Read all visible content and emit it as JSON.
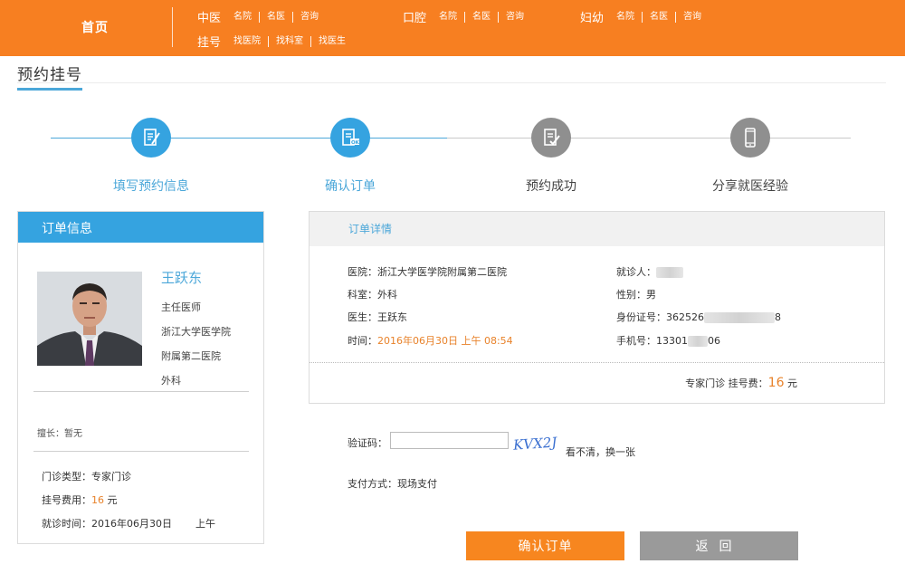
{
  "nav": {
    "home": "首页",
    "groups": [
      {
        "main": "中医",
        "subs": [
          "名院",
          "名医",
          "咨询"
        ]
      },
      {
        "main": "口腔",
        "subs": [
          "名院",
          "名医",
          "咨询"
        ]
      },
      {
        "main": "妇幼",
        "subs": [
          "名院",
          "名医",
          "咨询"
        ]
      },
      {
        "main": "挂号",
        "subs": [
          "找医院",
          "找科室",
          "找医生"
        ]
      }
    ]
  },
  "page_title": "预约挂号",
  "steps": [
    {
      "label": "填写预约信息",
      "state": "done"
    },
    {
      "label": "确认订单",
      "state": "active"
    },
    {
      "label": "预约成功",
      "state": "pending"
    },
    {
      "label": "分享就医经验",
      "state": "pending"
    }
  ],
  "order_info": {
    "title": "订单信息",
    "doctor_name": "王跃东",
    "doctor_title": "主任医师",
    "hospital_line1": "浙江大学医学院",
    "hospital_line2": "附属第二医院",
    "dept": "外科",
    "specialty": "擅长：暂无",
    "clinic_type_label": "门诊类型：",
    "clinic_type": "专家门诊",
    "fee_label": "挂号费用：",
    "fee_value": "16",
    "fee_unit": " 元",
    "visit_time_label": "就诊时间：",
    "visit_date": "2016年06月30日",
    "visit_period": "上午"
  },
  "order_detail": {
    "title": "订单详情",
    "hospital": "医院：浙江大学医学院附属第二医院",
    "dept": "科室：外科",
    "doctor": "医生：王跃东",
    "time_label": "时间：",
    "time_value": "2016年06月30日 上午 08:54",
    "patient_label": "就诊人：",
    "gender": "性别：男",
    "id_label": "身份证号：",
    "id_prefix": "362526",
    "id_suffix": "8",
    "phone_label": "手机号：",
    "phone_prefix": "13301",
    "phone_suffix": "06",
    "fee_prefix": "专家门诊 挂号费：",
    "fee_value": "16",
    "fee_unit": " 元"
  },
  "captcha": {
    "label": "验证码：",
    "value": "",
    "image_text": "KVX2J",
    "refresh": "看不清，换一张"
  },
  "payment": "支付方式：现场支付",
  "buttons": {
    "confirm": "确认订单",
    "back": "返回"
  },
  "colors": {
    "topbar": "#f77f21",
    "accent_blue": "#35a3e0",
    "orange_text": "#e8822a",
    "step_gray": "#8f8f8f"
  }
}
